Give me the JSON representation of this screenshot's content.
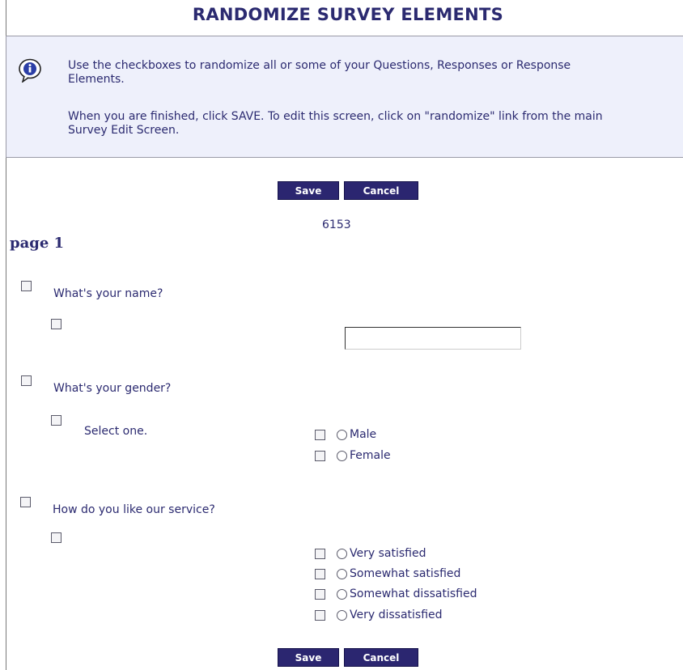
{
  "header": {
    "title": "RANDOMIZE SURVEY ELEMENTS"
  },
  "info": {
    "line1": "Use the checkboxes to randomize all or some of your Questions, Responses or Response\nElements.",
    "line2": "When you are finished, click SAVE. To edit this screen, click on \"randomize\" link from the main\nSurvey Edit Screen."
  },
  "buttons": {
    "save": "Save",
    "cancel": "Cancel"
  },
  "survey_id": "6153",
  "page_label": "page 1",
  "questions": [
    {
      "text": "What's your name?",
      "instruction": "",
      "input_value": ""
    },
    {
      "text": "What's your gender?",
      "instruction": "Select one.",
      "options": [
        "Male",
        "Female"
      ]
    },
    {
      "text": "How do you like our service?",
      "instruction": "",
      "options": [
        "Very satisfied",
        "Somewhat satisfied",
        "Somewhat dissatisfied",
        "Very dissatisfied"
      ]
    }
  ],
  "icons": {
    "info": "info-icon"
  },
  "colors": {
    "accent": "#2b2670",
    "text": "#2b2a70",
    "info_bg": "#eef0fb"
  }
}
